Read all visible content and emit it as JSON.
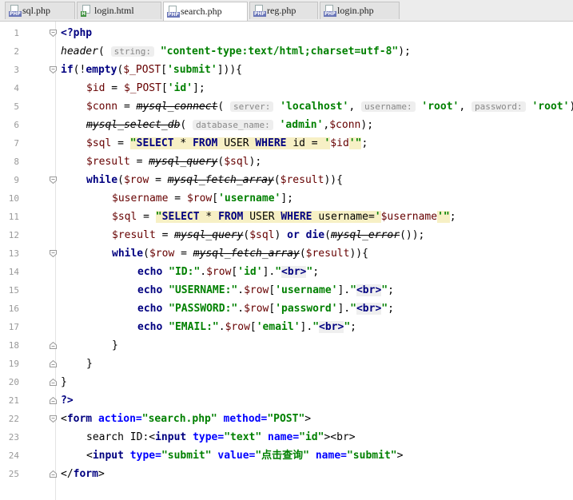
{
  "tabs": [
    {
      "name": "sql.php",
      "type": "php",
      "active": false
    },
    {
      "name": "login.html",
      "type": "html",
      "active": false
    },
    {
      "name": "search.php",
      "type": "php",
      "active": true
    },
    {
      "name": "reg.php",
      "type": "php",
      "active": false
    },
    {
      "name": "login.php",
      "type": "php",
      "active": false
    }
  ],
  "icon_labels": {
    "php": "PHP",
    "html": "H"
  },
  "line_numbers": [
    "1",
    "2",
    "3",
    "4",
    "5",
    "6",
    "7",
    "8",
    "9",
    "10",
    "11",
    "12",
    "13",
    "14",
    "15",
    "16",
    "17",
    "18",
    "19",
    "20",
    "21",
    "22",
    "23",
    "24",
    "25"
  ],
  "code": {
    "l1": {
      "open": "<?php"
    },
    "l2": {
      "fn": "header",
      "p1": "(",
      "hint": "string:",
      "str": "\"content-type:text/html;charset=utf-8\"",
      "end": ");"
    },
    "l3": {
      "kw": "if",
      "a": "(!",
      "kw2": "empty",
      "b": "(",
      "var": "$_POST",
      "c": "[",
      "str": "'submit'",
      "d": "])){"
    },
    "l4": {
      "var1": "$id",
      "eq": " = ",
      "var2": "$_POST",
      "c": "[",
      "str": "'id'",
      "d": "];"
    },
    "l5": {
      "var": "$conn",
      "eq": " = ",
      "fn": "mysql_connect",
      "p": "(",
      "h1": "server:",
      "s1": "'localhost'",
      "sep1": ", ",
      "h2": "username:",
      "s2": "'root'",
      "sep2": ", ",
      "h3": "password:",
      "s3": "'root'",
      "end": ");"
    },
    "l6": {
      "fn": "mysql_select_db",
      "p": "(",
      "h1": "database_name:",
      "s1": "'admin'",
      "rest": ",",
      "var": "$conn",
      "end": ");"
    },
    "l7": {
      "var": "$sql",
      "eq": " = ",
      "q1": "\"",
      "k1": "SELECT",
      "sp1": " * ",
      "k2": "FROM",
      "sp2": " USER ",
      "k3": "WHERE",
      "sp3": " id = ",
      "q2": "'",
      "var2": "$id",
      "q3": "'\"",
      "end": ";"
    },
    "l8": {
      "var": "$result",
      "eq": " = ",
      "fn": "mysql_query",
      "p": "(",
      "var2": "$sql",
      "end": ");"
    },
    "l9": {
      "kw": "while",
      "p": "(",
      "var": "$row",
      "eq": " = ",
      "fn": "mysql_fetch_array",
      "p2": "(",
      "var2": "$result",
      "end": ")){"
    },
    "l10": {
      "var": "$username",
      "eq": " = ",
      "var2": "$row",
      "c": "[",
      "str": "'username'",
      "d": "];"
    },
    "l11": {
      "var": "$sql",
      "eq": " = ",
      "q1": "\"",
      "k1": "SELECT",
      "sp1": " * ",
      "k2": "FROM",
      "sp2": " USER ",
      "k3": "WHERE",
      "sp3": " username=",
      "q2": "'",
      "var2": "$username",
      "q3": "'\"",
      "end": ";"
    },
    "l12": {
      "var": "$result",
      "eq": " = ",
      "fn": "mysql_query",
      "p": "(",
      "var2": "$sql",
      "p2": ") ",
      "kw": "or",
      "sp": " ",
      "kw2": "die",
      "p3": "(",
      "fn2": "mysql_error",
      "end": "());"
    },
    "l13": {
      "kw": "while",
      "p": "(",
      "var": "$row",
      "eq": " = ",
      "fn": "mysql_fetch_array",
      "p2": "(",
      "var2": "$result",
      "end": ")){"
    },
    "l14": {
      "kw": "echo",
      "sp": " ",
      "s1": "\"ID:\"",
      "dot": ".",
      "var": "$row",
      "c": "[",
      "s2": "'id'",
      "d": "].",
      "s3": "\"",
      "tag": "<br>",
      "s4": "\"",
      "end": ";"
    },
    "l15": {
      "kw": "echo",
      "sp": " ",
      "s1": "\"USERNAME:\"",
      "dot": ".",
      "var": "$row",
      "c": "[",
      "s2": "'username'",
      "d": "].",
      "s3": "\"",
      "tag": "<br>",
      "s4": "\"",
      "end": ";"
    },
    "l16": {
      "kw": "echo",
      "sp": " ",
      "s1": "\"PASSWORD:\"",
      "dot": ".",
      "var": "$row",
      "c": "[",
      "s2": "'password'",
      "d": "].",
      "s3": "\"",
      "tag": "<br>",
      "s4": "\"",
      "end": ";"
    },
    "l17": {
      "kw": "echo",
      "sp": " ",
      "s1": "\"EMAIL:\"",
      "dot": ".",
      "var": "$row",
      "c": "[",
      "s2": "'email'",
      "d": "].",
      "s3": "\"",
      "tag": "<br>",
      "s4": "\"",
      "end": ";"
    },
    "l18": {
      "t": "}"
    },
    "l19": {
      "t": "}"
    },
    "l20": {
      "t": "}"
    },
    "l21": {
      "close": "?>"
    },
    "l22": {
      "lt": "<",
      "tag": "form",
      "sp1": " ",
      "a1": "action=",
      "v1": "\"search.php\"",
      "sp2": " ",
      "a2": "method=",
      "v2": "\"POST\"",
      "gt": ">"
    },
    "l23": {
      "txt": "search ID:",
      "lt": "<",
      "tag": "input",
      "sp1": " ",
      "a1": "type=",
      "v1": "\"text\"",
      "sp2": " ",
      "a2": "name=",
      "v2": "\"id\"",
      "gt": ">",
      "br": "<br>"
    },
    "l24": {
      "lt": "<",
      "tag": "input",
      "sp1": " ",
      "a1": "type=",
      "v1": "\"submit\"",
      "sp2": " ",
      "a2": "value=",
      "v2": "\"点击查询\"",
      "sp3": " ",
      "a3": "name=",
      "v3": "\"submit\"",
      "gt": ">"
    },
    "l25": {
      "lt": "</",
      "tag": "form",
      "gt": ">"
    }
  }
}
